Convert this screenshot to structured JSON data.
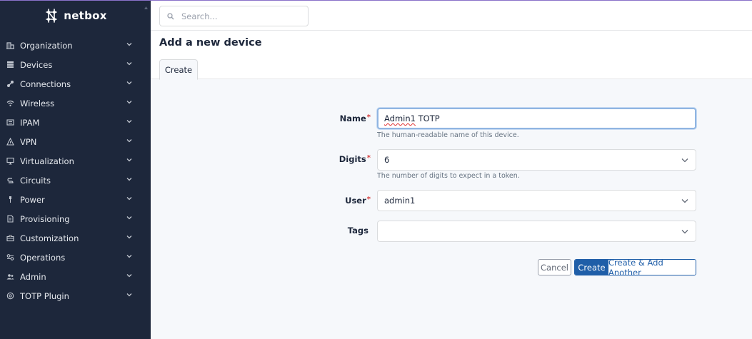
{
  "brand": {
    "name": "netbox"
  },
  "sidebar": {
    "items": [
      {
        "label": "Organization",
        "icon": "building-icon"
      },
      {
        "label": "Devices",
        "icon": "server-icon"
      },
      {
        "label": "Connections",
        "icon": "connection-icon"
      },
      {
        "label": "Wireless",
        "icon": "wifi-icon"
      },
      {
        "label": "IPAM",
        "icon": "counter-icon"
      },
      {
        "label": "VPN",
        "icon": "vpn-icon"
      },
      {
        "label": "Virtualization",
        "icon": "monitor-icon"
      },
      {
        "label": "Circuits",
        "icon": "circuits-icon"
      },
      {
        "label": "Power",
        "icon": "flash-icon"
      },
      {
        "label": "Provisioning",
        "icon": "file-icon"
      },
      {
        "label": "Customization",
        "icon": "toolbox-icon"
      },
      {
        "label": "Operations",
        "icon": "operations-icon"
      },
      {
        "label": "Admin",
        "icon": "users-icon"
      },
      {
        "label": "TOTP Plugin",
        "icon": "plugin-icon"
      }
    ]
  },
  "search": {
    "placeholder": "Search..."
  },
  "page": {
    "title": "Add a new device",
    "tab": "Create"
  },
  "form": {
    "name": {
      "label": "Name",
      "required": "*",
      "value": "Admin1 TOTP",
      "value_prefix": "Admin1",
      "value_suffix": " TOTP",
      "help": "The human-readable name of this device."
    },
    "digits": {
      "label": "Digits",
      "required": "*",
      "value": "6",
      "help": "The number of digits to expect in a token."
    },
    "user": {
      "label": "User",
      "required": "*",
      "value": "admin1"
    },
    "tags": {
      "label": "Tags",
      "value": ""
    }
  },
  "buttons": {
    "cancel": "Cancel",
    "create": "Create",
    "create_add": "Create & Add Another"
  },
  "colors": {
    "sidebar_bg": "#1d273b",
    "primary": "#1f5ea8",
    "required": "#d63939",
    "focus": "#90b5e2"
  }
}
